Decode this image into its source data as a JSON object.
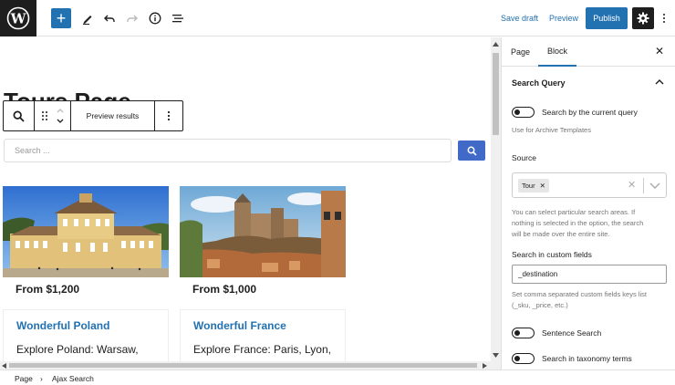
{
  "topbar": {
    "add_symbol": "+",
    "save_draft": "Save draft",
    "preview": "Preview",
    "publish": "Publish"
  },
  "editor": {
    "page_title": "Tours Page",
    "toolbar": {
      "preview_results": "Preview results"
    },
    "search": {
      "placeholder": "Search ..."
    },
    "cards": [
      {
        "price": "From $1,200",
        "title": "Wonderful Poland",
        "desc": "Explore Poland: Warsaw,"
      },
      {
        "price": "From $1,000",
        "title": "Wonderful France",
        "desc": "Explore France: Paris, Lyon,"
      }
    ]
  },
  "sidebar": {
    "tabs": [
      "Page",
      "Block"
    ],
    "active_tab": "Block",
    "close_symbol": "✕",
    "panel_title": "Search Query",
    "current_query_label": "Search by the current query",
    "current_query_help": "Use for Archive Templates",
    "source_label": "Source",
    "source_chip": "Tour",
    "source_chip_remove": "✕",
    "source_clear": "✕",
    "source_help_1": "You can select particular search areas. If",
    "source_help_2": "nothing is selected in the option, the search",
    "source_help_3": "will be made over the entire site.",
    "custom_fields_label": "Search in custom fields",
    "custom_fields_value": "_destination",
    "custom_fields_help_1": "Set comma separated custom fields keys list",
    "custom_fields_help_2": "(_sku, _price, etc.)",
    "sentence_search": "Sentence Search",
    "taxonomy_search": "Search in taxonomy terms"
  },
  "footer": {
    "breadcrumb": [
      "Page",
      "Ajax Search"
    ],
    "separator": "›"
  },
  "colors": {
    "accent": "#2271b1",
    "search_button": "#4169c8",
    "dark": "#1e1e1e"
  }
}
